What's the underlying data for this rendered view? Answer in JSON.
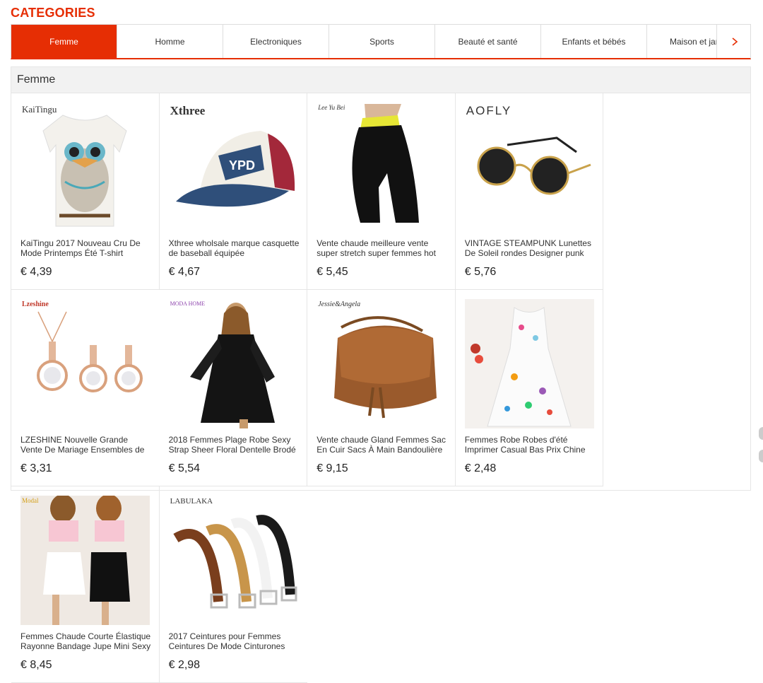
{
  "categories_title": "CATEGORIES",
  "tabs": [
    {
      "label": "Femme"
    },
    {
      "label": "Homme"
    },
    {
      "label": "Electroniques"
    },
    {
      "label": "Sports"
    },
    {
      "label": "Beauté et santé"
    },
    {
      "label": "Enfants et bébés"
    },
    {
      "label": "Maison et jardin"
    }
  ],
  "section_title": "Femme",
  "products": [
    {
      "brand": "KaiTingu",
      "title": "KaiTingu 2017 Nouveau Cru De Mode Printemps Été T-shirt",
      "price": "€ 4,39",
      "image": "owl-tshirt"
    },
    {
      "brand": "Xthree",
      "title": "Xthree wholsale marque casquette de baseball équipée",
      "price": "€ 4,67",
      "image": "baseball-cap"
    },
    {
      "brand": "Lee Yu Bei",
      "title": "Vente chaude meilleure vente super stretch super femmes hot",
      "price": "€ 5,45",
      "image": "leggings"
    },
    {
      "brand": "AOFLY",
      "title": "VINTAGE STEAMPUNK Lunettes De Soleil rondes Designer punk de",
      "price": "€ 5,76",
      "image": "sunglasses"
    },
    {
      "brand": "Lzeshine",
      "title": "LZESHINE Nouvelle Grande Vente De Mariage Ensembles de Bijoux",
      "price": "€ 3,31",
      "image": "jewelry-set"
    },
    {
      "brand": "MODA HOME",
      "title": "2018 Femmes Plage Robe Sexy Strap Sheer Floral Dentelle Brodé",
      "price": "€ 5,54",
      "image": "black-dress"
    },
    {
      "brand": "Jessie&Angela",
      "title": "Vente chaude Gland Femmes Sac En Cuir Sacs À Main Bandoulière",
      "price": "€ 9,15",
      "image": "leather-bag"
    },
    {
      "brand": "",
      "title": "Femmes Robe Robes d'été Imprimer Casual Bas Prix Chine",
      "price": "€ 2,48",
      "image": "summer-dress"
    },
    {
      "brand": "Modal",
      "title": "Femmes Chaude Courte Élastique Rayonne Bandage Jupe Mini Sexy",
      "price": "€ 8,45",
      "image": "mini-skirts"
    },
    {
      "brand": "LABULAKA",
      "title": "2017 Ceintures pour Femmes Ceintures De Mode Cinturones",
      "price": "€ 2,98",
      "image": "belts"
    }
  ],
  "colors": {
    "accent": "#e62e04"
  },
  "icons": {
    "next": "chevron-right-icon"
  }
}
